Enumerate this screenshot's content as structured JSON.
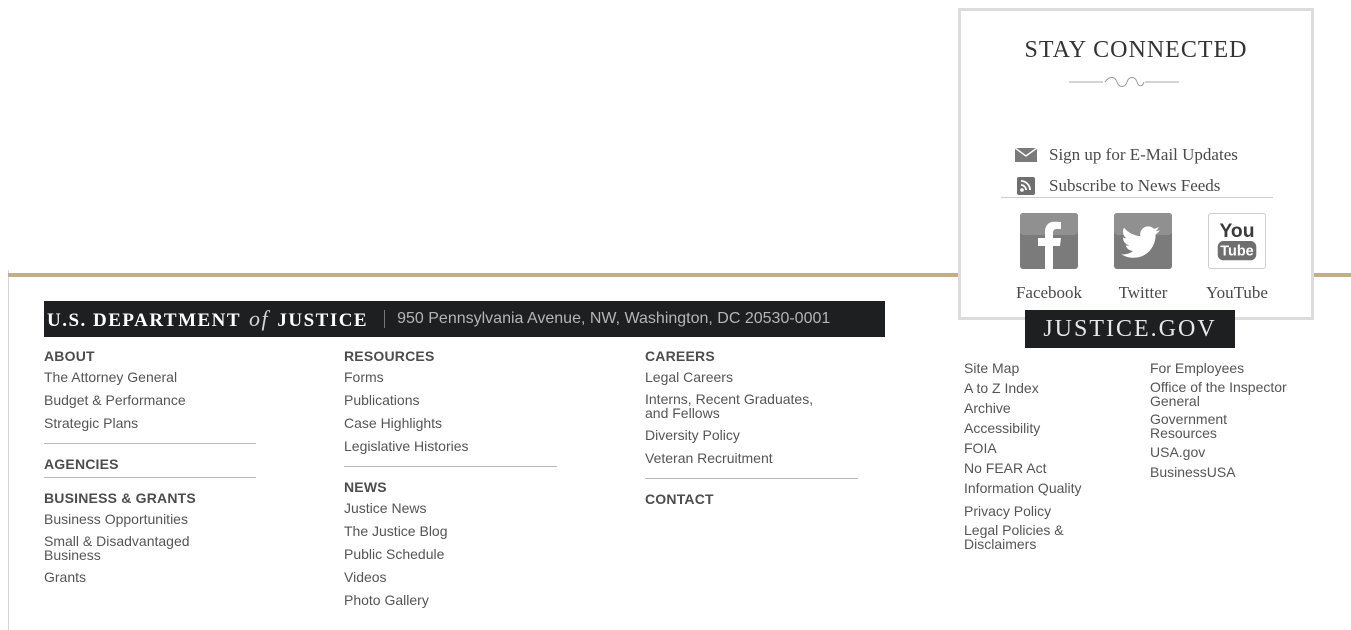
{
  "stay_connected": {
    "title": "STAY CONNECTED",
    "email_link": "Sign up for E-Mail Updates",
    "feeds_link": "Subscribe to News Feeds",
    "social": [
      {
        "label": "Facebook",
        "icon": "facebook-icon"
      },
      {
        "label": "Twitter",
        "icon": "twitter-icon"
      },
      {
        "label": "YouTube",
        "icon": "youtube-icon"
      }
    ],
    "youtube_logo_top": "You",
    "youtube_logo_bottom": "Tube"
  },
  "header": {
    "logo_left": "U.S. DEPARTMENT",
    "logo_of": "of",
    "logo_right": "JUSTICE",
    "address": "950 Pennsylvania Avenue, NW, Washington, DC 20530-0001"
  },
  "justice_gov": "JUSTICE.GOV",
  "columns": {
    "about": {
      "heading": "ABOUT",
      "links": [
        "The Attorney General",
        "Budget & Performance",
        "Strategic Plans"
      ]
    },
    "agencies": {
      "heading": "AGENCIES"
    },
    "business": {
      "heading": "BUSINESS & GRANTS",
      "links": [
        "Business Opportunities",
        "Small & Disadvantaged Business",
        "Grants"
      ]
    },
    "resources": {
      "heading": "RESOURCES",
      "links": [
        "Forms",
        "Publications",
        "Case Highlights",
        "Legislative Histories"
      ]
    },
    "news": {
      "heading": "NEWS",
      "links": [
        "Justice News",
        "The Justice Blog",
        "Public Schedule",
        "Videos",
        "Photo Gallery"
      ]
    },
    "careers": {
      "heading": "CAREERS",
      "links": [
        "Legal Careers",
        "Interns, Recent Graduates, and Fellows",
        "Diversity Policy",
        "Veteran Recruitment"
      ]
    },
    "contact": {
      "heading": "CONTACT"
    }
  },
  "justice_links": {
    "left": [
      "Site Map",
      "A to Z Index",
      "Archive",
      "Accessibility",
      "FOIA",
      "No FEAR Act",
      "Information Quality",
      "Privacy Policy",
      "Legal Policies & Disclaimers"
    ],
    "right": [
      "For Employees",
      "Office of the Inspector General",
      "Government Resources",
      "USA.gov",
      "BusinessUSA"
    ]
  },
  "colors": {
    "gold_rule": "#c4ae84",
    "dark_bar": "#1e1f20",
    "icon_gray": "#808080"
  }
}
